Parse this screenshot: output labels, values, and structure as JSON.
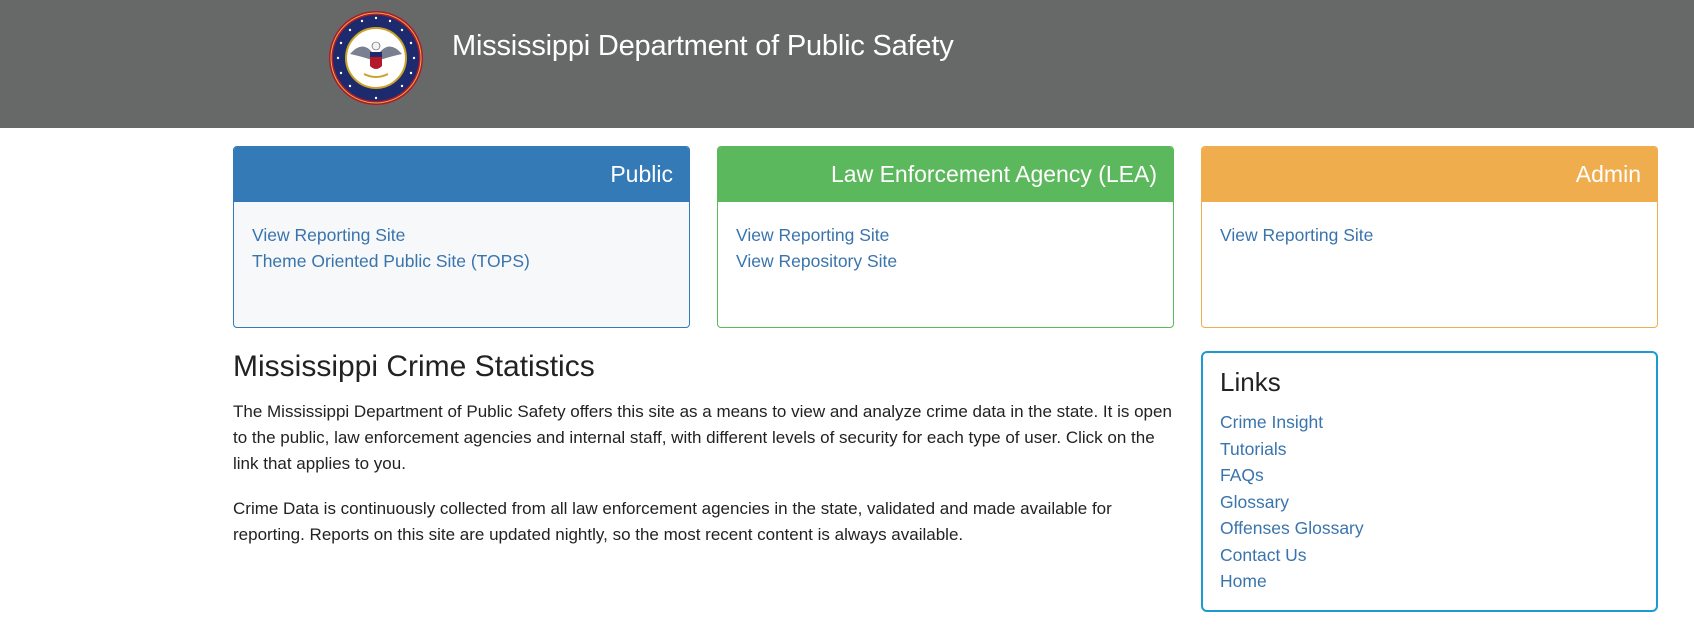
{
  "header": {
    "title": "Mississippi Department of Public Safety",
    "seal_text": "MISSISSIPPI DEPARTMENT OF PUBLIC SAFETY · IN GOD WE TRUST"
  },
  "panels": {
    "public": {
      "title": "Public",
      "links": [
        "View Reporting Site",
        "Theme Oriented Public Site (TOPS)"
      ]
    },
    "lea": {
      "title": "Law Enforcement Agency (LEA)",
      "links": [
        "View Reporting Site",
        "View Repository Site"
      ]
    },
    "admin": {
      "title": "Admin",
      "links": [
        "View Reporting Site"
      ]
    }
  },
  "main": {
    "heading": "Mississippi Crime Statistics",
    "paragraphs": [
      "The Mississippi Department of Public Safety offers this site as a means to view and analyze crime data in the state. It is open to the public, law enforcement agencies and internal staff, with different levels of security for each type of user. Click on the link that applies to you.",
      "Crime Data is continuously collected from all law enforcement agencies in the state, validated and made available for reporting. Reports on this site are updated nightly, so the most recent content is always available."
    ]
  },
  "links": {
    "title": "Links",
    "items": [
      "Crime Insight",
      "Tutorials",
      "FAQs",
      "Glossary",
      "Offenses Glossary",
      "Contact Us",
      "Home"
    ]
  },
  "colors": {
    "header_bg": "#676868",
    "public": "#337ab7",
    "lea": "#5cb85c",
    "admin": "#f0ad4e",
    "link": "#3a74ad",
    "links_border": "#1d9bd1"
  }
}
